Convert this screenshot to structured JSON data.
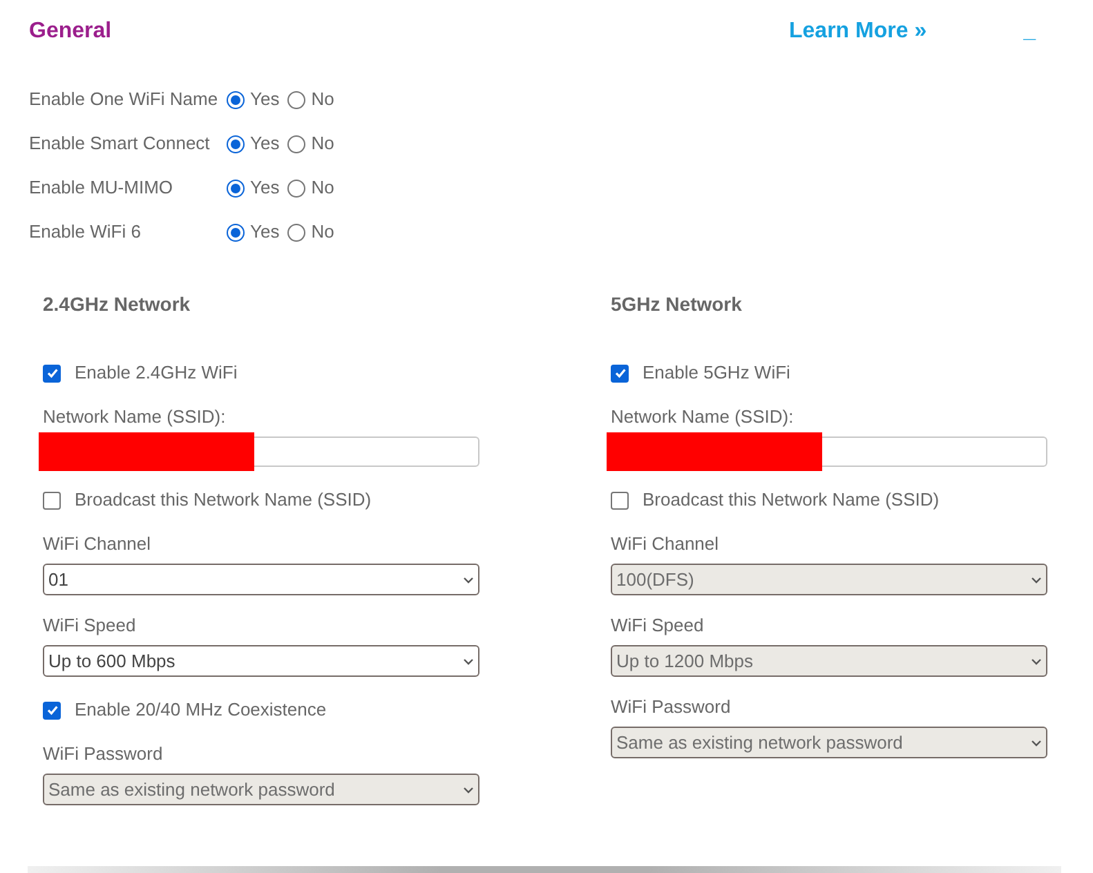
{
  "title": "General",
  "learn_more": "Learn More »",
  "minimize": "_",
  "settings": [
    {
      "label": "Enable One WiFi Name",
      "options": [
        {
          "label": "Yes",
          "selected": true
        },
        {
          "label": "No",
          "selected": false
        }
      ]
    },
    {
      "label": "Enable Smart Connect",
      "options": [
        {
          "label": "Yes",
          "selected": true
        },
        {
          "label": "No",
          "selected": false
        }
      ]
    },
    {
      "label": "Enable MU-MIMO",
      "options": [
        {
          "label": "Yes",
          "selected": true
        },
        {
          "label": "No",
          "selected": false
        }
      ]
    },
    {
      "label": "Enable WiFi 6",
      "options": [
        {
          "label": "Yes",
          "selected": true
        },
        {
          "label": "No",
          "selected": false
        }
      ]
    }
  ],
  "networks": [
    {
      "title": "2.4GHz Network",
      "fields": [
        {
          "kind": "checkbox",
          "label": "Enable 2.4GHz WiFi",
          "checked": true
        },
        {
          "kind": "text",
          "label": "Network Name (SSID):",
          "redacted": true
        },
        {
          "kind": "checkbox",
          "label": "Broadcast this Network Name (SSID)",
          "checked": false
        },
        {
          "kind": "select",
          "label": "WiFi Channel",
          "value": "01",
          "disabled": false
        },
        {
          "kind": "select",
          "label": "WiFi Speed",
          "value": "Up to 600 Mbps",
          "disabled": false
        },
        {
          "kind": "checkbox",
          "label": "Enable 20/40 MHz Coexistence",
          "checked": true
        },
        {
          "kind": "select",
          "label": "WiFi Password",
          "value": "Same as existing network password",
          "disabled": true
        }
      ]
    },
    {
      "title": "5GHz Network",
      "fields": [
        {
          "kind": "checkbox",
          "label": "Enable 5GHz WiFi",
          "checked": true
        },
        {
          "kind": "text",
          "label": "Network Name (SSID):",
          "redacted": true
        },
        {
          "kind": "checkbox",
          "label": "Broadcast this Network Name (SSID)",
          "checked": false
        },
        {
          "kind": "select",
          "label": "WiFi Channel",
          "value": "100(DFS)",
          "disabled": true
        },
        {
          "kind": "select",
          "label": "WiFi Speed",
          "value": "Up to 1200 Mbps",
          "disabled": true
        },
        {
          "kind": "select",
          "label": "WiFi Password",
          "value": "Same as existing network password",
          "disabled": true
        }
      ]
    }
  ]
}
